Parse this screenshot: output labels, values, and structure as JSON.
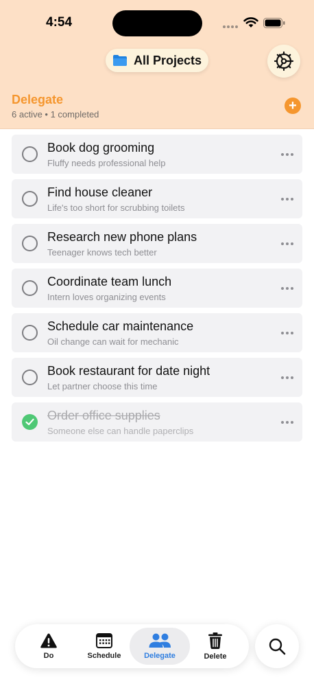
{
  "status_bar": {
    "time": "4:54"
  },
  "header": {
    "project_selector_label": "All Projects",
    "folder_icon": "folder-icon",
    "settings_icon": "gear-icon",
    "accent_color": "#f5962e",
    "background_color": "#fde0c6"
  },
  "section": {
    "title": "Delegate",
    "subtitle": "6 active • 1 completed",
    "add_icon": "plus-icon"
  },
  "tasks": [
    {
      "title": "Book dog grooming",
      "note": "Fluffy needs professional help",
      "completed": false
    },
    {
      "title": "Find house cleaner",
      "note": "Life's too short for scrubbing toilets",
      "completed": false
    },
    {
      "title": "Research new phone plans",
      "note": "Teenager knows tech better",
      "completed": false
    },
    {
      "title": "Coordinate team lunch",
      "note": "Intern loves organizing events",
      "completed": false
    },
    {
      "title": "Schedule car maintenance",
      "note": "Oil change can wait for mechanic",
      "completed": false
    },
    {
      "title": "Book restaurant for date night",
      "note": "Let partner choose this time",
      "completed": false
    },
    {
      "title": "Order office supplies",
      "note": "Someone else can handle paperclips",
      "completed": true
    }
  ],
  "tabbar": {
    "tabs": [
      {
        "label": "Do",
        "icon": "warning-icon",
        "active": false
      },
      {
        "label": "Schedule",
        "icon": "calendar-icon",
        "active": false
      },
      {
        "label": "Delegate",
        "icon": "people-icon",
        "active": true
      },
      {
        "label": "Delete",
        "icon": "trash-icon",
        "active": false
      }
    ],
    "active_color": "#2f7ee0",
    "search_icon": "search-icon"
  }
}
